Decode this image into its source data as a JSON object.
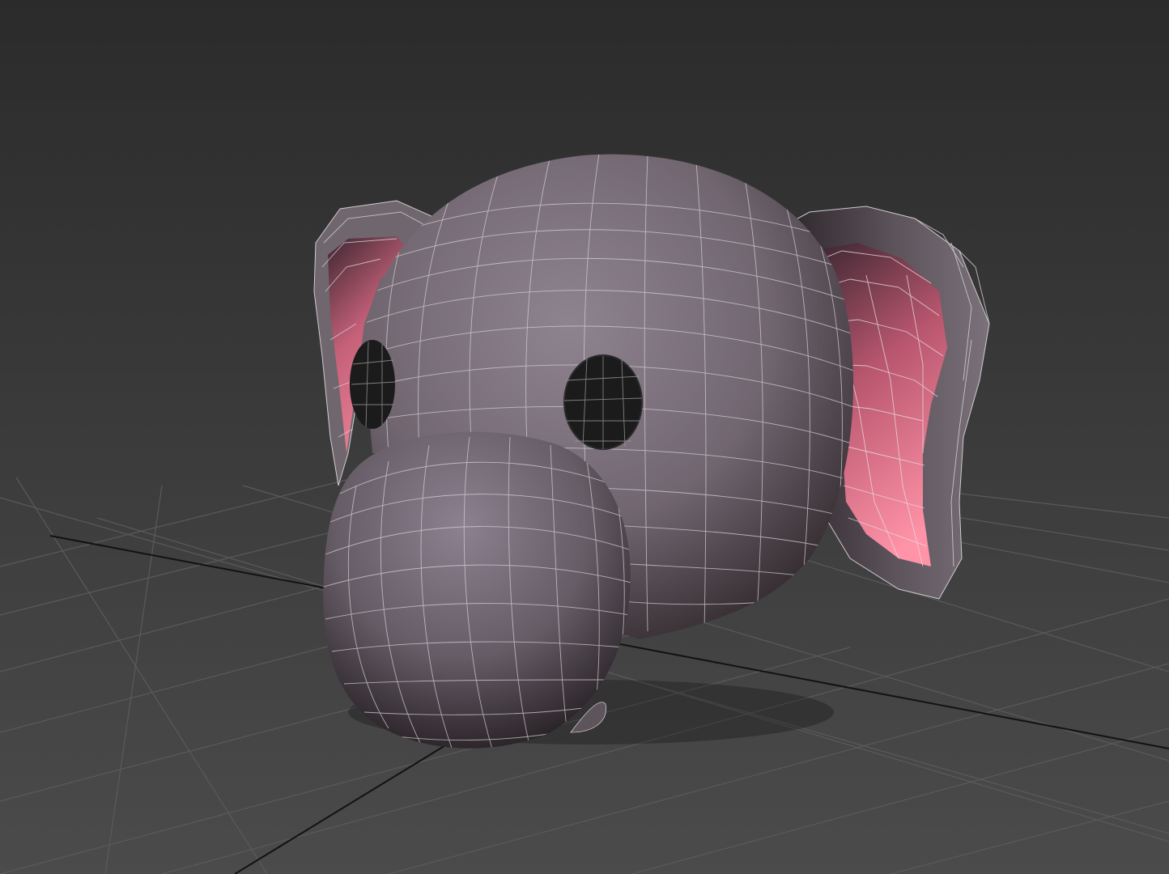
{
  "viewport": {
    "background_top": "#2b2b2b",
    "background_bottom": "#4a4a4a",
    "grid_color": "#5c5c5c",
    "axis_color": "#141414"
  },
  "model": {
    "subject": "elephant-head",
    "skin_color": "#8a7f88",
    "skin_shadow": "#2a2228",
    "ear_inner_color": "#ff8aa0",
    "wireframe_color": "#d8d4d8",
    "eye_color": "#1a1a1a"
  }
}
